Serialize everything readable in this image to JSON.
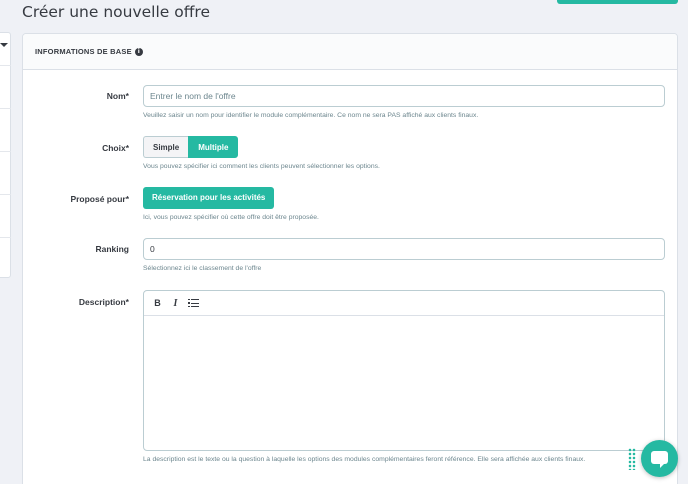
{
  "page": {
    "title": "Créer une nouvelle offre"
  },
  "card": {
    "title": "INFORMATIONS DE BASE",
    "info_icon": "i"
  },
  "form": {
    "name": {
      "label": "Nom*",
      "placeholder": "Entrer le nom de l'offre",
      "value": "",
      "help": "Veuillez saisir un nom pour identifier le module complémentaire. Ce nom ne sera PAS affiché aux clients finaux."
    },
    "choice": {
      "label": "Choix*",
      "options": [
        "Simple",
        "Multiple"
      ],
      "selected": "Multiple",
      "help": "Vous pouvez spécifier ici comment les clients peuvent sélectionner les options."
    },
    "proposed_for": {
      "label": "Proposé pour*",
      "button": "Réservation pour les activités",
      "help": "Ici, vous pouvez spécifier où cette offre doit être proposée."
    },
    "ranking": {
      "label": "Ranking",
      "value": "0",
      "help": "Sélectionnez ici le classement de l'offre"
    },
    "description": {
      "label": "Description*",
      "toolbar": {
        "bold": "B",
        "italic": "I",
        "list_icon": "list-icon"
      },
      "help": "La description est le texte ou la question à laquelle les options des modules complémentaires feront référence. Elle sera affichée aux clients finaux."
    }
  },
  "colors": {
    "accent": "#25b9a2",
    "background": "#eff1f6",
    "text": "#363a41",
    "muted": "#6c868e"
  },
  "chat": {
    "icon": "chat-icon"
  }
}
